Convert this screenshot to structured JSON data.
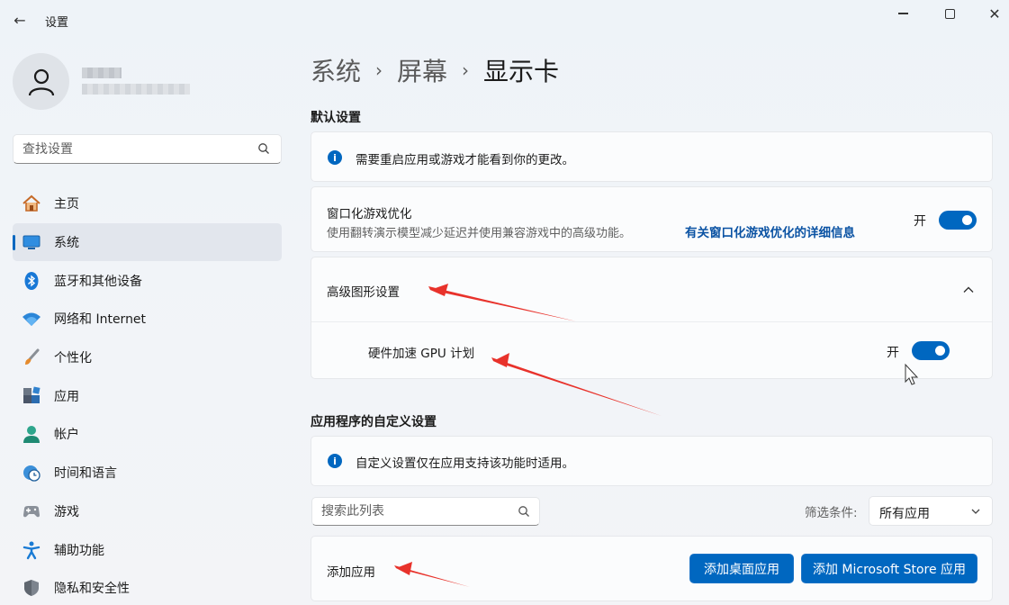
{
  "window": {
    "title": "设置",
    "back_icon": "arrow-left-icon",
    "min_icon": "minimize-icon",
    "max_icon": "maximize-icon",
    "close_icon": "close-icon",
    "close_glyph": "✕",
    "back_glyph": "←"
  },
  "sidebar": {
    "search_placeholder": "查找设置",
    "items": [
      {
        "label": "主页",
        "icon": "home-icon"
      },
      {
        "label": "系统",
        "icon": "display-icon",
        "active": true
      },
      {
        "label": "蓝牙和其他设备",
        "icon": "bluetooth-icon"
      },
      {
        "label": "网络和 Internet",
        "icon": "wifi-icon"
      },
      {
        "label": "个性化",
        "icon": "brush-icon"
      },
      {
        "label": "应用",
        "icon": "apps-icon"
      },
      {
        "label": "帐户",
        "icon": "person-icon"
      },
      {
        "label": "时间和语言",
        "icon": "clock-globe-icon"
      },
      {
        "label": "游戏",
        "icon": "gamepad-icon"
      },
      {
        "label": "辅助功能",
        "icon": "accessibility-icon"
      },
      {
        "label": "隐私和安全性",
        "icon": "shield-icon"
      }
    ]
  },
  "breadcrumb": {
    "items": [
      "系统",
      "屏幕",
      "显示卡"
    ],
    "separator": "›"
  },
  "default_settings": {
    "title": "默认设置",
    "info_text": "需要重启应用或游戏才能看到你的更改。",
    "windowed_title": "窗口化游戏优化",
    "windowed_desc": "使用翻转演示模型减少延迟并使用兼容游戏中的高级功能。",
    "windowed_link": "有关窗口化游戏优化的详细信息",
    "windowed_state": "开",
    "advanced_title": "高级图形设置",
    "gpu_title": "硬件加速 GPU 计划",
    "gpu_state": "开"
  },
  "custom_settings": {
    "title": "应用程序的自定义设置",
    "info_text": "自定义设置仅在应用支持该功能时适用。",
    "list_search_placeholder": "搜索此列表",
    "filter_label": "筛选条件:",
    "filter_value": "所有应用",
    "add_app_label": "添加应用",
    "add_desktop_button": "添加桌面应用",
    "add_store_button": "添加 Microsoft Store 应用"
  },
  "colors": {
    "accent": "#0067c0",
    "link": "#0a52a3",
    "arrow": "#e8322b"
  }
}
